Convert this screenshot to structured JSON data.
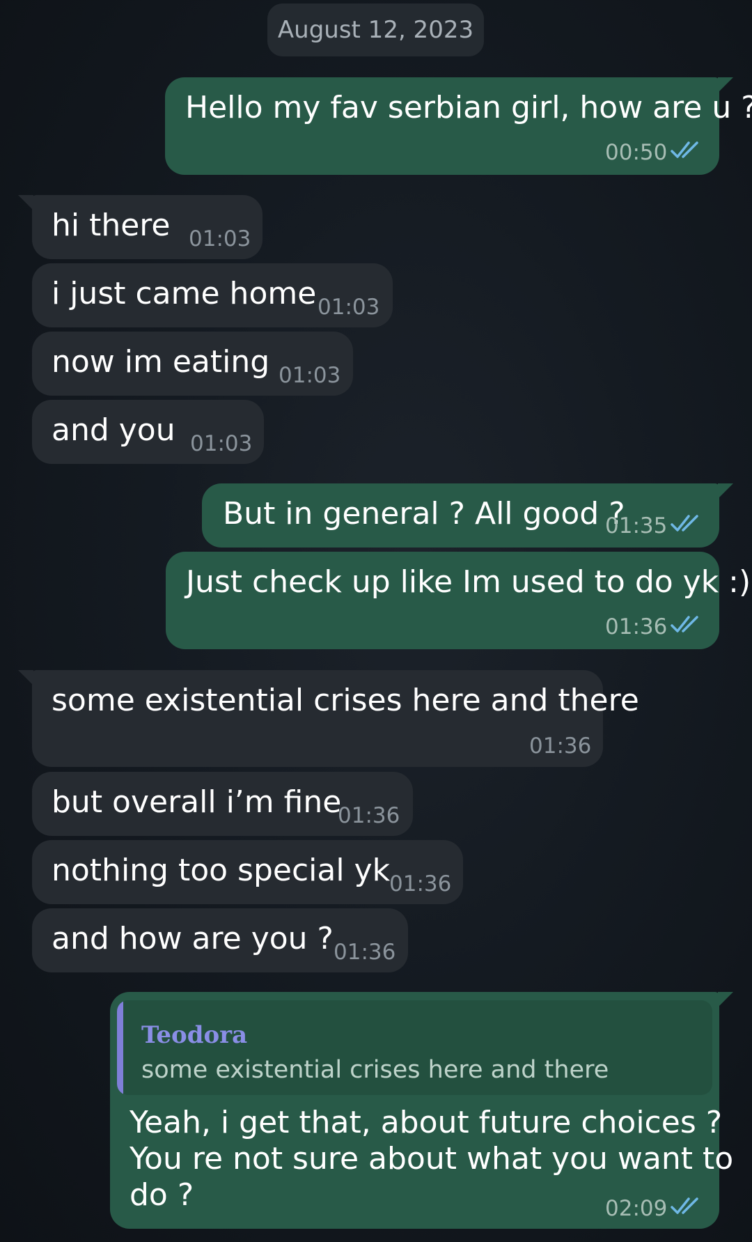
{
  "date_chip": "August 12, 2023",
  "colors": {
    "incoming_bubble": "#262b31",
    "outgoing_bubble": "#285a48",
    "read_checks": "#6fb8e6",
    "quote_accent": "#7f7fd8"
  },
  "messages": [
    {
      "text": "Hello my fav serbian girl, how are u ?",
      "time": "00:50",
      "status": "read-check-icon"
    },
    {
      "text": "hi there",
      "time": "01:03"
    },
    {
      "text": "i just came home",
      "time": "01:03"
    },
    {
      "text": "now im eating",
      "time": "01:03"
    },
    {
      "text": "and you",
      "time": "01:03"
    },
    {
      "text": "But in general ? All good ?",
      "time": "01:35",
      "status": "read-check-icon"
    },
    {
      "text": "Just check up like Im used to do yk :)",
      "time": "01:36",
      "status": "read-check-icon"
    },
    {
      "text": "some existential crises here and there",
      "time": "01:36"
    },
    {
      "text": "but overall i’m fine",
      "time": "01:36"
    },
    {
      "text": "nothing too special yk",
      "time": "01:36"
    },
    {
      "text": "and how are you ?",
      "time": "01:36"
    },
    {
      "quote": {
        "author": "Teodora",
        "text": "some existential crises here and there"
      },
      "lines": [
        "Yeah, i get that, about future choices ?",
        "You re not sure about what you want to",
        "do ?"
      ],
      "time": "02:09",
      "status": "read-check-icon"
    }
  ]
}
